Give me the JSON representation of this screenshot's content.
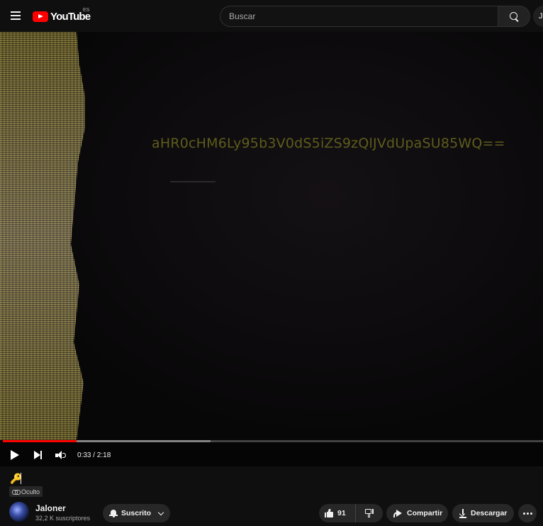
{
  "header": {
    "logo_text": "YouTube",
    "logo_region": "ES",
    "search_placeholder": "Buscar",
    "mic_stub": "J"
  },
  "player": {
    "overlay_text": "aHR0cHM6Ly95b3V0dS5iZS9zQlJVdUpaSU85WQ==",
    "current_time": "0:33",
    "duration": "2:18",
    "time_display": "0:33 / 2:18",
    "progress_played_fraction": 0.136,
    "progress_buffered_fraction": 0.384
  },
  "video": {
    "title_icon": "key-icon",
    "visibility_label": "Oculto"
  },
  "channel": {
    "name": "Jaloner",
    "subscribers": "32,2 K suscriptores",
    "subscribe_label": "Suscrito"
  },
  "actions": {
    "like_count": "91",
    "share_label": "Compartir",
    "download_label": "Descargar"
  },
  "colors": {
    "accent": "#ff0000",
    "background": "#0f0f0f",
    "pill": "#272727",
    "overlay_text": "#5e5c1c"
  }
}
